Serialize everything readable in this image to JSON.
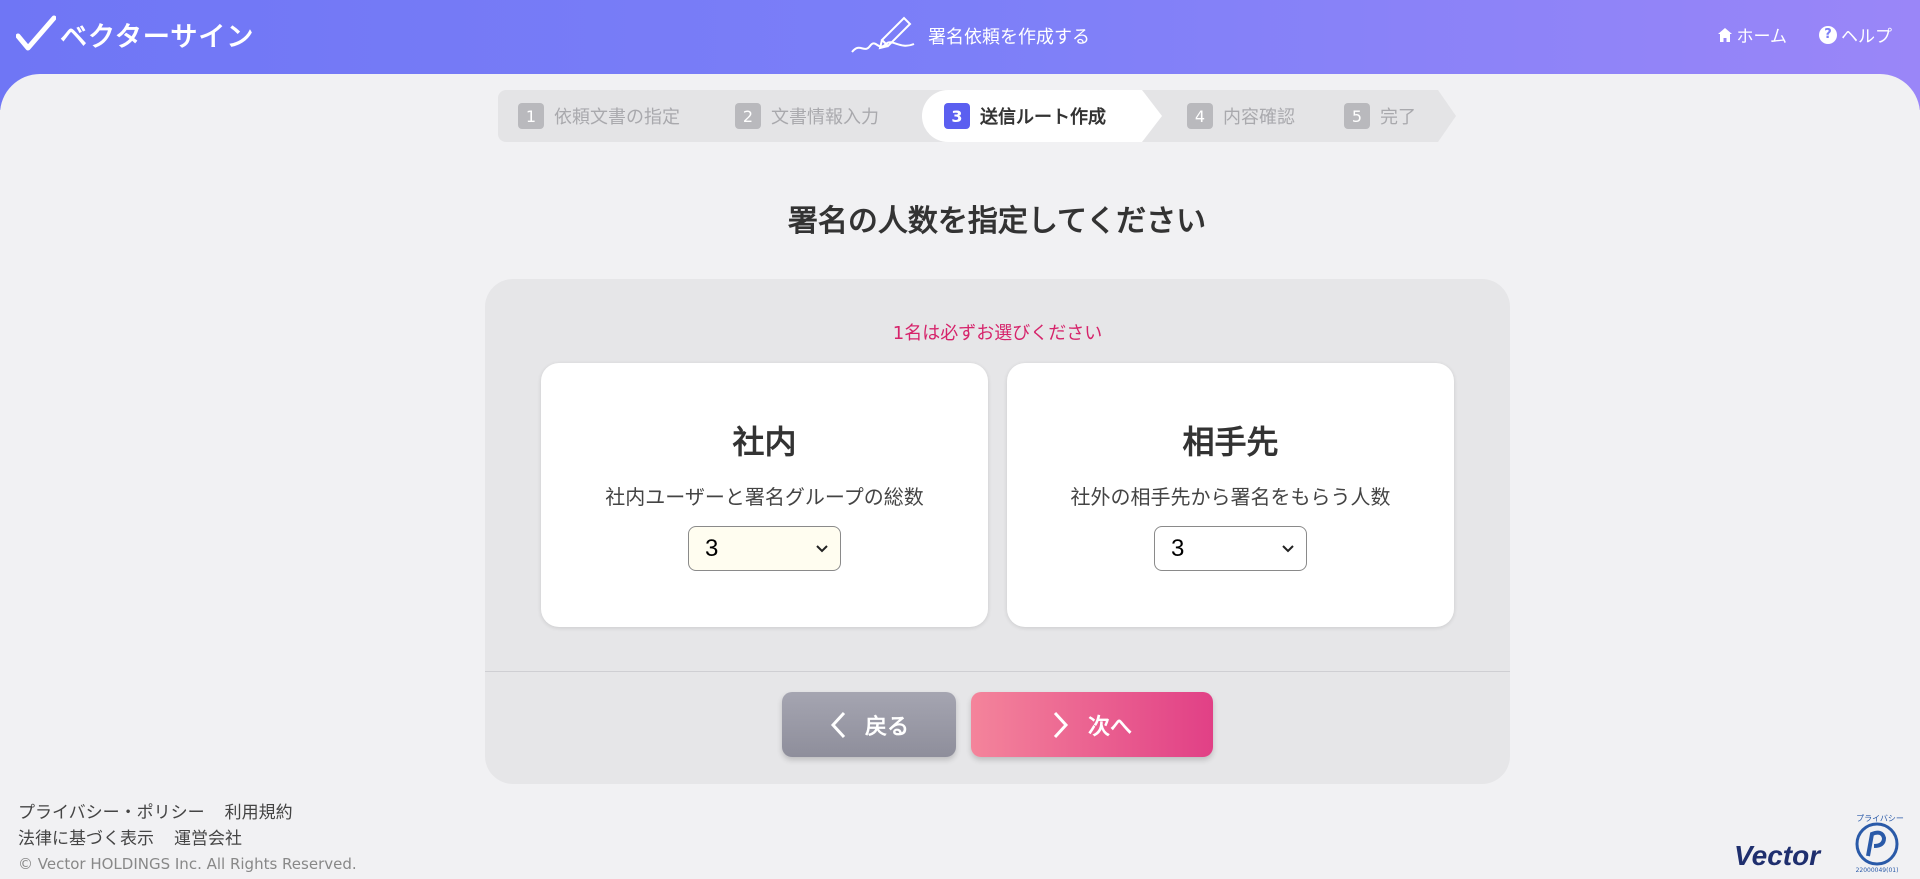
{
  "header": {
    "brand": "ベクターサイン",
    "page_title": "署名依頼を作成する",
    "nav": [
      {
        "label": "ホーム",
        "icon": "home-icon"
      },
      {
        "label": "ヘルプ",
        "icon": "help-icon"
      }
    ]
  },
  "stepper": {
    "steps": [
      {
        "num": "1",
        "label": "依頼文書の指定"
      },
      {
        "num": "2",
        "label": "文書情報入力"
      },
      {
        "num": "3",
        "label": "送信ルート作成"
      },
      {
        "num": "4",
        "label": "内容確認"
      },
      {
        "num": "5",
        "label": "完了"
      }
    ],
    "active": 3
  },
  "main": {
    "title": "署名の人数を指定してください",
    "notice": "1名は必ずお選びください",
    "cards": [
      {
        "title": "社内",
        "description": "社内ユーザーと署名グループの総数",
        "selected": "3"
      },
      {
        "title": "相手先",
        "description": "社外の相手先から署名をもらう人数",
        "selected": "3"
      }
    ],
    "back_label": "戻る",
    "next_label": "次へ"
  },
  "footer": {
    "privacy": "プライバシー・ポリシー",
    "terms": "利用規約",
    "legal": "法律に基づく表示",
    "company": "運営会社",
    "copyright": "© Vector HOLDINGS Inc. All Rights Reserved.",
    "vector_logo": "Vector",
    "pmark_text": "プライバシー",
    "pmark_id": "22000049(01)"
  },
  "colors": {
    "header_start": "#6f76f5",
    "active_step": "#5b5ff0",
    "notice": "#d6246b",
    "next_button": "#e14086",
    "back_button": "#9a9aa6"
  }
}
